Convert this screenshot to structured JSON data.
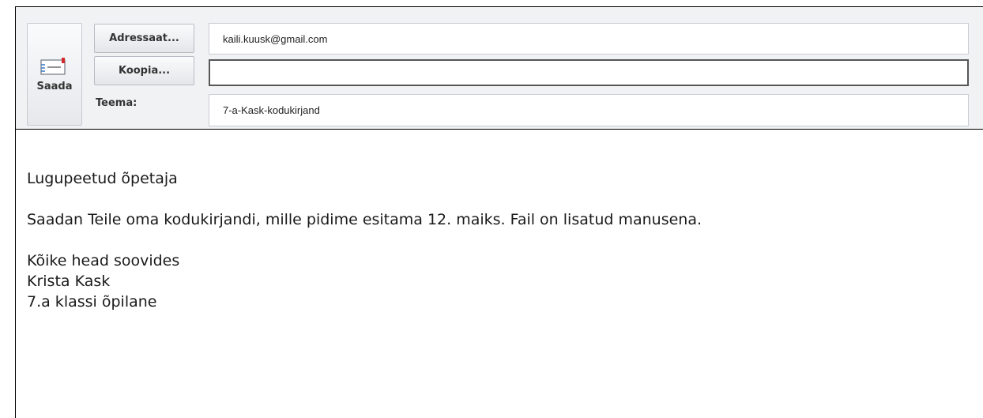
{
  "compose": {
    "send_label": "Saada",
    "to_button_label": "Adressaat...",
    "cc_button_label": "Koopia...",
    "subject_label": "Teema:",
    "to_value": "kaili.kuusk@gmail.com",
    "cc_value": "",
    "subject_value": "7-a-Kask-kodukirjand"
  },
  "message": {
    "greeting": "Lugupeetud õpetaja",
    "paragraph": "Saadan Teile oma kodukirjandi, mille pidime esitama 12. maiks. Fail on lisatud manusena.",
    "closing": "Kõike head soovides",
    "sender_name": "Krista Kask",
    "sender_role": "7.a klassi õpilane"
  },
  "colors": {
    "header_bg": "#f1f2f4",
    "icon_red": "#d12b2b",
    "icon_blue": "#3a79c5"
  },
  "icons": {
    "send": "envelope-send-icon"
  }
}
